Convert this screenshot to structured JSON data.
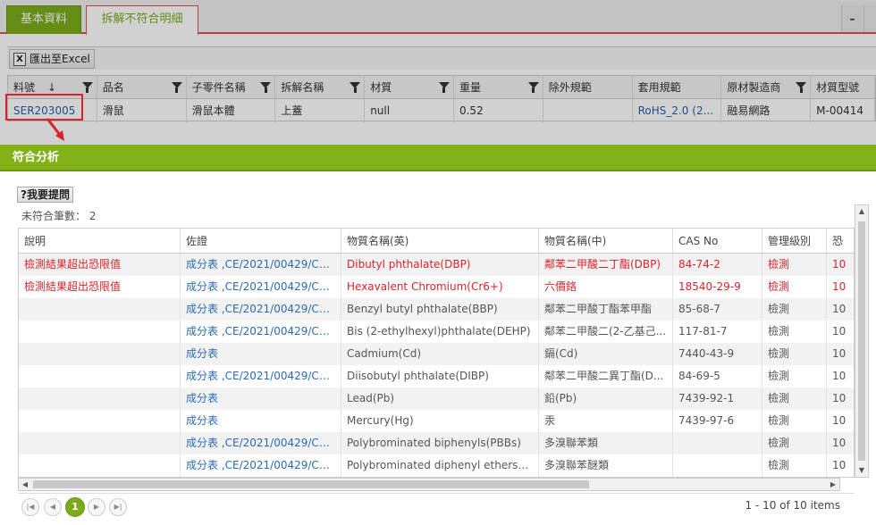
{
  "tabs": [
    {
      "label": "基本資料"
    },
    {
      "label": "拆解不符合明細"
    }
  ],
  "window": {
    "minimize_label": "–"
  },
  "toolbar": {
    "export_label": "匯出至Excel",
    "excel_icon_glyph": "X"
  },
  "bg_grid": {
    "columns": [
      "料號",
      "品名",
      "子零件名稱",
      "拆解名稱",
      "材質",
      "重量",
      "除外規範",
      "套用規範",
      "原材製造商",
      "材質型號"
    ],
    "row": [
      "SER203005",
      "滑鼠",
      "滑鼠本體",
      "上蓋",
      "null",
      "0.52",
      "",
      "RoHS_2.0 (2...",
      "融易網路",
      "M-00414"
    ],
    "sort_glyph": "↓"
  },
  "dialog": {
    "title": "符合分析",
    "ask_button": "?我要提問",
    "count_text": "未符合筆數： 2",
    "columns": [
      "說明",
      "佐證",
      "物質名稱(英)",
      "物質名稱(中)",
      "CAS No",
      "管理級別",
      "恐"
    ],
    "rows": [
      {
        "desc": "檢測結果超出恐限值",
        "proof": "成分表 ,CE/2021/00429/Cover",
        "en": "Dibutyl phthalate(DBP)",
        "zh": "鄰苯二甲酸二丁酯(DBP)",
        "cas": "84-74-2",
        "level": "檢測",
        "extra": "10",
        "fail": true
      },
      {
        "desc": "檢測結果超出恐限值",
        "proof": "成分表 ,CE/2021/00429/Cover",
        "en": "Hexavalent Chromium(Cr6+)",
        "zh": "六價鉻",
        "cas": "18540-29-9",
        "level": "檢測",
        "extra": "10",
        "fail": true
      },
      {
        "desc": "",
        "proof": "成分表 ,CE/2021/00429/Cover",
        "en": "Benzyl butyl phthalate(BBP)",
        "zh": "鄰苯二甲酸丁酯苯甲酯",
        "cas": "85-68-7",
        "level": "檢測",
        "extra": "10",
        "fail": false
      },
      {
        "desc": "",
        "proof": "成分表 ,CE/2021/00429/Cover",
        "en": "Bis (2-ethylhexyl)phthalate(DEHP)",
        "zh": "鄰苯二甲酸二(2-乙基己...",
        "cas": "117-81-7",
        "level": "檢測",
        "extra": "10",
        "fail": false
      },
      {
        "desc": "",
        "proof": "成分表",
        "en": "Cadmium(Cd)",
        "zh": "鎘(Cd)",
        "cas": "7440-43-9",
        "level": "檢測",
        "extra": "10",
        "fail": false
      },
      {
        "desc": "",
        "proof": "成分表 ,CE/2021/00429/Cover",
        "en": "Diisobutyl phthalate(DIBP)",
        "zh": "鄰苯二甲酸二異丁酯(D...",
        "cas": "84-69-5",
        "level": "檢測",
        "extra": "10",
        "fail": false
      },
      {
        "desc": "",
        "proof": "成分表",
        "en": "Lead(Pb)",
        "zh": "鉛(Pb)",
        "cas": "7439-92-1",
        "level": "檢測",
        "extra": "10",
        "fail": false
      },
      {
        "desc": "",
        "proof": "成分表",
        "en": "Mercury(Hg)",
        "zh": "汞",
        "cas": "7439-97-6",
        "level": "檢測",
        "extra": "10",
        "fail": false
      },
      {
        "desc": "",
        "proof": "成分表 ,CE/2021/00429/Cover",
        "en": "Polybrominated biphenyls(PBBs)",
        "zh": "多溴聯苯類",
        "cas": "",
        "level": "檢測",
        "extra": "10",
        "fail": false
      },
      {
        "desc": "",
        "proof": "成分表 ,CE/2021/00429/Cover",
        "en": "Polybrominated diphenyl ethers(PB...",
        "zh": "多溴聯苯醚類",
        "cas": "",
        "level": "檢測",
        "extra": "10",
        "fail": false
      }
    ],
    "pager": {
      "current_page": "1",
      "info": "1 - 10 of 10 items"
    }
  },
  "colors": {
    "brand_green": "#83b118",
    "alert_red": "#d9232a",
    "link_blue": "#2a6ab0"
  }
}
